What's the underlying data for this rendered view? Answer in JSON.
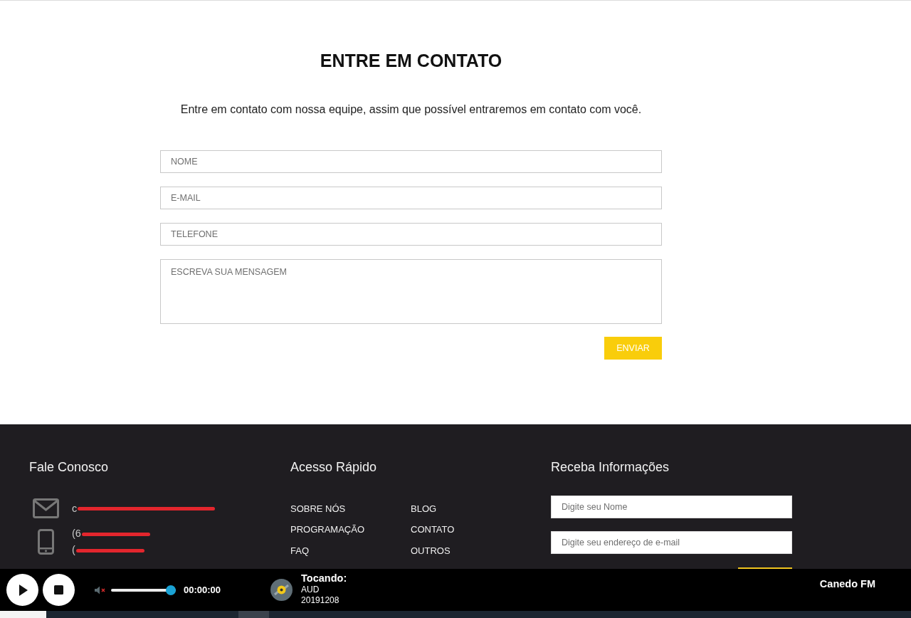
{
  "contact_section": {
    "title": "ENTRE EM CONTATO",
    "subtitle": "Entre em contato com nossa equipe, assim que possível entraremos em contato com você.",
    "fields": [
      {
        "kind": "input",
        "placeholder": "NOME"
      },
      {
        "kind": "input",
        "placeholder": "E-MAIL"
      },
      {
        "kind": "input",
        "placeholder": "TELEFONE"
      },
      {
        "kind": "textarea",
        "placeholder": "ESCREVA SUA MENSAGEM"
      }
    ],
    "submit_button": "ENVIAR"
  },
  "footer": {
    "contact": {
      "heading": "Fale Conosco",
      "items": [
        {
          "kind": "email",
          "lines": [
            "c"
          ],
          "redacted": true
        },
        {
          "kind": "phone",
          "lines": [
            "(6",
            "("
          ],
          "redacted": true
        }
      ]
    },
    "quick_links": {
      "heading": "Acesso Rápido",
      "columns": [
        [
          "SOBRE NÓS",
          "PROGRAMAÇÃO",
          "FAQ"
        ],
        [
          "BLOG",
          "CONTATO",
          "OUTROS"
        ]
      ]
    },
    "newsletter": {
      "heading": "Receba Informações",
      "fields": [
        {
          "placeholder": "Digite seu Nome"
        },
        {
          "placeholder": "Digite seu endereço de e-mail"
        }
      ]
    }
  },
  "player": {
    "muted": true,
    "volume": {
      "level": 1.0
    },
    "time": "00:00:00",
    "now_playing": {
      "label": "Tocando:",
      "lines": [
        "AUD",
        "20191208"
      ]
    },
    "station": "Canedo FM"
  }
}
